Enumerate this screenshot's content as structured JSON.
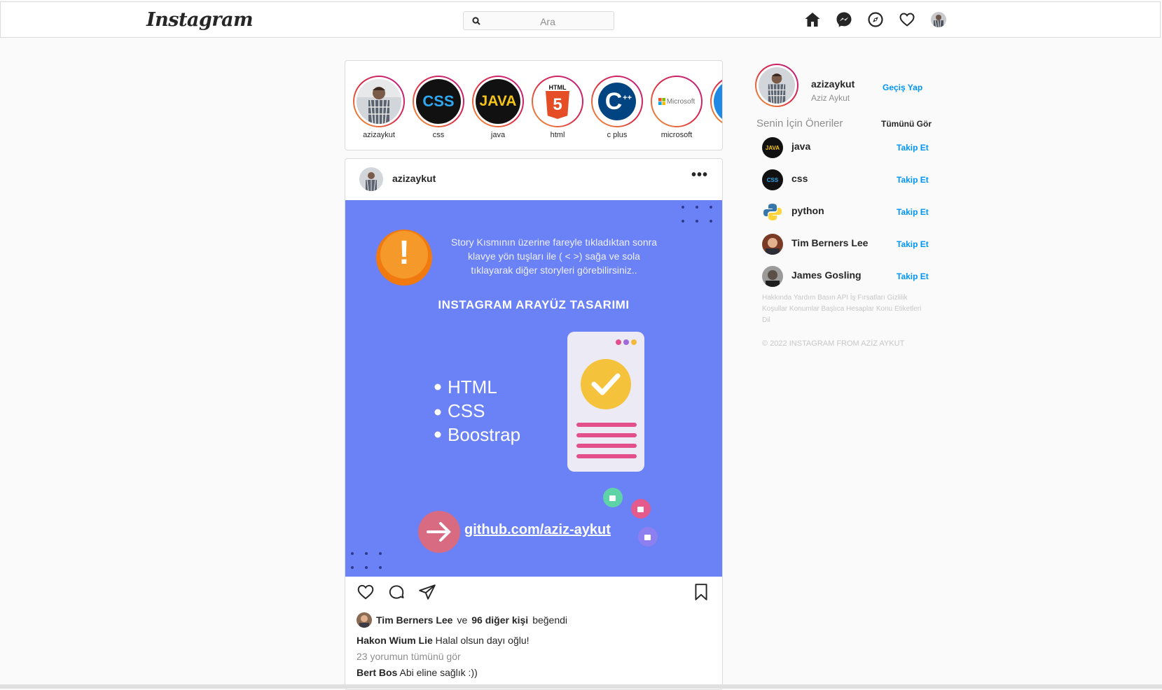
{
  "nav": {
    "logo": "Instagram",
    "search_placeholder": "Ara",
    "icons": [
      "home-icon",
      "messenger-icon",
      "explore-icon",
      "heart-icon",
      "profile-avatar"
    ]
  },
  "stories": [
    {
      "label": "azizaykut",
      "kind": "photo"
    },
    {
      "label": "css",
      "kind": "css"
    },
    {
      "label": "java",
      "kind": "java"
    },
    {
      "label": "html",
      "kind": "html"
    },
    {
      "label": "c plus",
      "kind": "cpp"
    },
    {
      "label": "microsoft",
      "kind": "microsoft"
    }
  ],
  "story_logo_text": {
    "css": "CSS",
    "java": "JAVA",
    "html": "HTML",
    "html_number": "5",
    "cpp": "C",
    "cpp_plus": "++",
    "microsoft": "Microsoft"
  },
  "post": {
    "username": "azizaykut",
    "more": "•••",
    "image": {
      "info_line1": "Story Kısmının üzerine fareyle tıkladıktan sonra",
      "info_line2": "klavye yön tuşları ile ( <  >) sağa ve sola",
      "info_line3": "tıklayarak diğer storyleri görebilirsiniz..",
      "alert_mark": "!",
      "heading": "INSTAGRAM ARAYÜZ TASARIMI",
      "bullets": [
        "HTML",
        "CSS",
        "Boostrap"
      ],
      "link": "github.com/aziz-aykut",
      "colors": {
        "bg": "#6b81f6"
      }
    },
    "liked_by_user": "Tim Berners Lee",
    "liked_by_and": "ve",
    "liked_by_others": "96 diğer kişi",
    "liked_suffix": "beğendi",
    "comments": [
      {
        "user": "Hakon Wium Lie",
        "text": "Halal olsun dayı oğlu!"
      },
      {
        "user": "Bert Bos",
        "text": "Abi eline sağlık :))"
      }
    ],
    "view_all_comments": "23 yorumun tümünü gör"
  },
  "sidebar": {
    "username": "azizaykut",
    "fullname": "Aziz Aykut",
    "switch_label": "Geçiş Yap",
    "suggestions_title": "Senin İçin Öneriler",
    "see_all": "Tümünü Gör",
    "suggestions": [
      {
        "name": "java",
        "follow": "Takip Et",
        "avatar_text": "JAVA"
      },
      {
        "name": "css",
        "follow": "Takip Et",
        "avatar_text": "CSS"
      },
      {
        "name": "python",
        "follow": "Takip Et",
        "avatar_text": ""
      },
      {
        "name": "Tim Berners Lee",
        "follow": "Takip Et",
        "avatar_text": ""
      },
      {
        "name": "James Gosling",
        "follow": "Takip Et",
        "avatar_text": ""
      }
    ],
    "footer_links": "Hakkında Yardım Basın API İş Fırsatları Gizlilik Koşullar Konumlar Başlıca Hesaplar Konu Etiketleri Dil",
    "copyright": "© 2022 INSTAGRAM FROM AZİZ AYKUT"
  },
  "colors": {
    "accent": "#0095f6",
    "border": "#dbdbdb",
    "background": "#fafafa"
  }
}
